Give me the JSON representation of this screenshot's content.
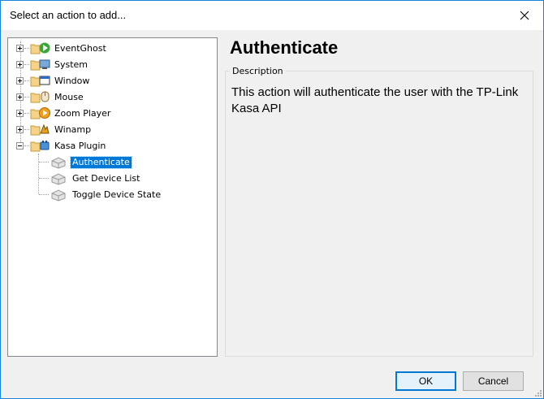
{
  "window": {
    "title": "Select an action to add...",
    "close_icon": "close-icon",
    "accent_color": "#1883d7"
  },
  "tree": {
    "plugins": [
      {
        "label": "EventGhost",
        "icon": "eventghost-icon",
        "expanded": false
      },
      {
        "label": "System",
        "icon": "system-icon",
        "expanded": false
      },
      {
        "label": "Window",
        "icon": "window-icon",
        "expanded": false
      },
      {
        "label": "Mouse",
        "icon": "mouse-icon",
        "expanded": false
      },
      {
        "label": "Zoom Player",
        "icon": "zoomplayer-icon",
        "expanded": false
      },
      {
        "label": "Winamp",
        "icon": "winamp-icon",
        "expanded": false
      },
      {
        "label": "Kasa Plugin",
        "icon": "kasa-plugin-icon",
        "expanded": true
      }
    ],
    "actions": [
      {
        "label": "Authenticate",
        "icon": "action-icon",
        "selected": true
      },
      {
        "label": "Get Device List",
        "icon": "action-icon",
        "selected": false
      },
      {
        "label": "Toggle Device State",
        "icon": "action-icon",
        "selected": false
      }
    ],
    "selection_color": "#0078d7"
  },
  "details": {
    "title": "Authenticate",
    "group_label": "Description",
    "description": "This action will authenticate the user with the TP-Link Kasa API"
  },
  "buttons": {
    "ok": "OK",
    "cancel": "Cancel"
  }
}
